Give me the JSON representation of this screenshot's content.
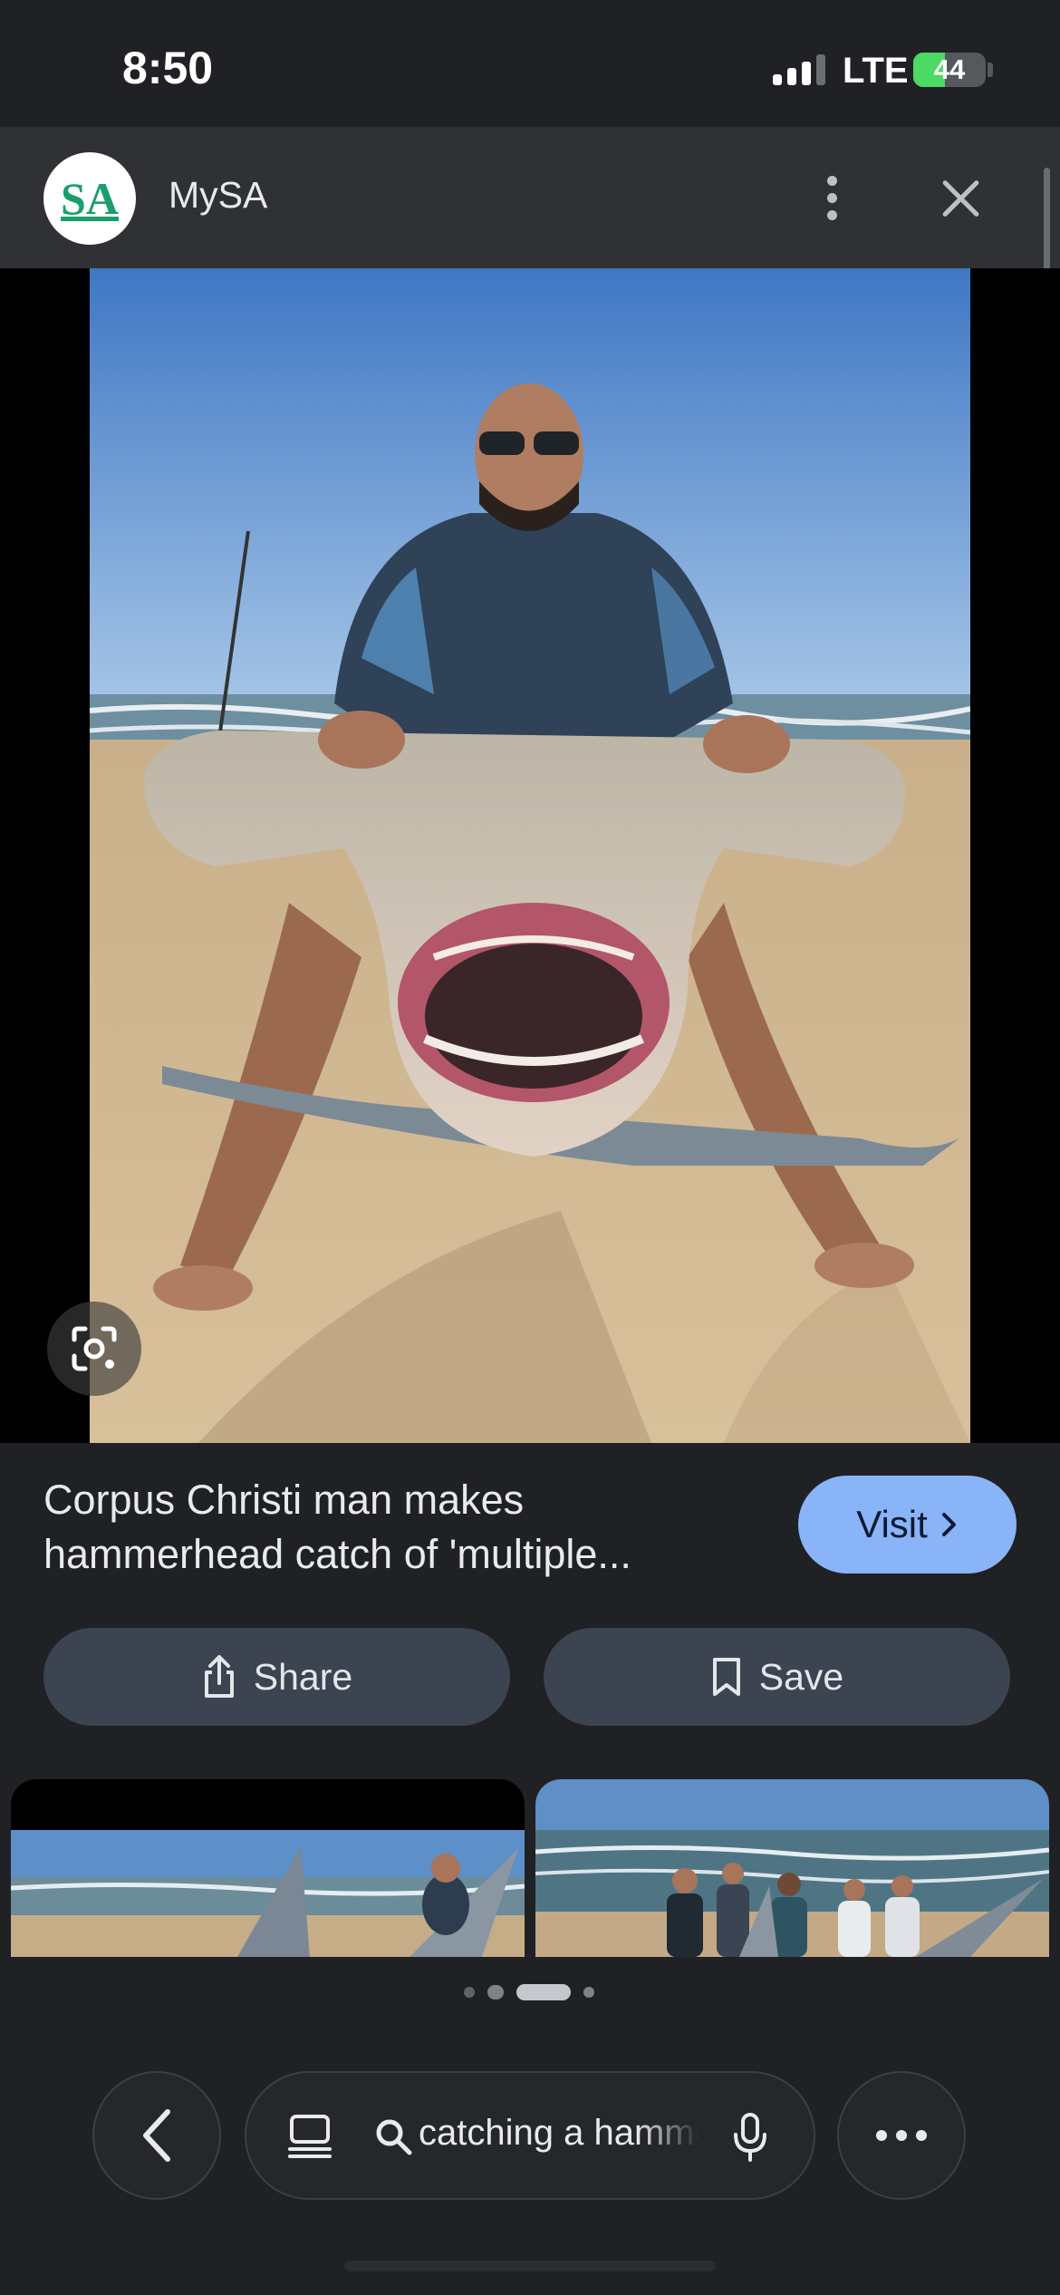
{
  "status_bar": {
    "time": "8:50",
    "network": "LTE",
    "battery": "44",
    "battery_level": 0.44,
    "signal_bars": 3
  },
  "header": {
    "source_logo_text": "SA",
    "source_name": "MySA",
    "more_icon": "more-vertical-icon",
    "close_icon": "close-icon"
  },
  "image_viewer": {
    "image_alt": "Man on a beach holding a large hammerhead shark",
    "lens_icon": "lens-icon"
  },
  "result": {
    "title": "Corpus Christi man makes hammerhead catch of 'multiple...",
    "visit_label": "Visit"
  },
  "actions": {
    "share_label": "Share",
    "save_label": "Save"
  },
  "related": {
    "images": [
      {
        "alt": "Hammerhead shark fins on a beach with a man"
      },
      {
        "alt": "Group of people posing with a shark on the beach"
      }
    ],
    "page_count": 4,
    "current_page": 3
  },
  "bottom_bar": {
    "search_query": "catching a hammerhead",
    "back_icon": "back-icon",
    "tabs_icon": "tabs-icon",
    "search_icon": "search-icon",
    "mic_icon": "mic-icon",
    "more_icon": "more-horizontal-icon"
  },
  "colors": {
    "background": "#202124",
    "header": "#303134",
    "accent": "#8ab4f8",
    "action_button": "#3c4451"
  }
}
